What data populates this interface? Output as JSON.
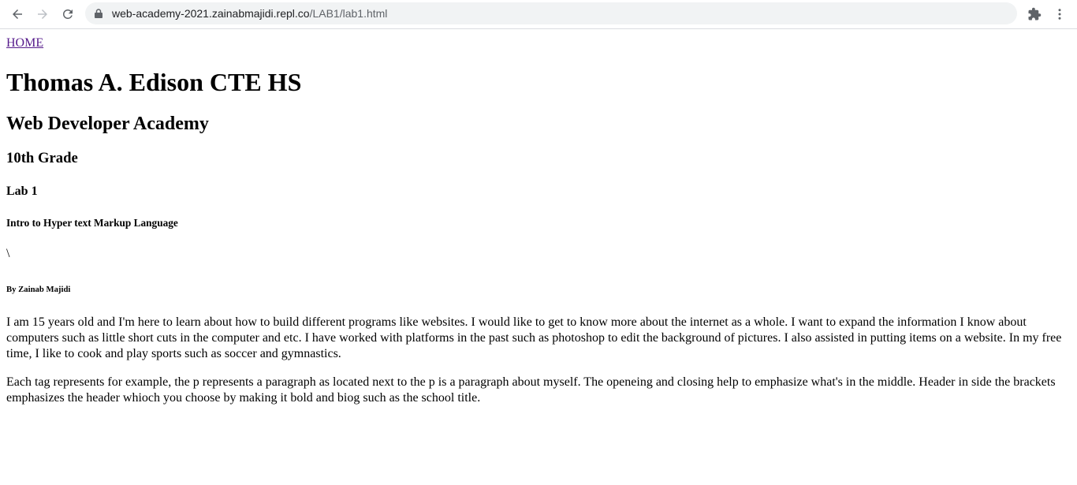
{
  "browser": {
    "url_host": "web-academy-2021.zainabmajidi.repl.co",
    "url_path": "/LAB1/lab1.html",
    "icons": [
      "back-icon",
      "forward-icon",
      "reload-icon",
      "lock-icon",
      "extensions-icon",
      "kebab-menu-icon"
    ]
  },
  "page": {
    "home_link": "HOME",
    "h1": "Thomas A. Edison CTE HS",
    "h2": "Web Developer Academy",
    "h3": "10th Grade",
    "h4": "Lab 1",
    "h5": "Intro to Hyper text Markup Language",
    "stray_text": "\\",
    "h6": "By Zainab Majidi",
    "paragraphs": [
      "I am 15 years old and I'm here to learn about how to build different programs like websites. I would like to get to know more about the internet as a whole. I want to expand the information I know about computers such as little short cuts in the computer and etc. I have worked with platforms in the past such as photoshop to edit the background of pictures. I also assisted in putting items on a website. In my free time, I like to cook and play sports such as soccer and gymnastics.",
      "Each tag represents for example, the p represents a paragraph as located next to the p is a paragraph about myself. The openeing and closing help to emphasize what's in the middle. Header in side the brackets emphasizes the header whioch you choose by making it bold and biog such as the school title."
    ]
  },
  "colors": {
    "link_visited": "#551a8b",
    "omnibox_bg": "#f1f3f4",
    "icon_gray": "#5f6368"
  }
}
